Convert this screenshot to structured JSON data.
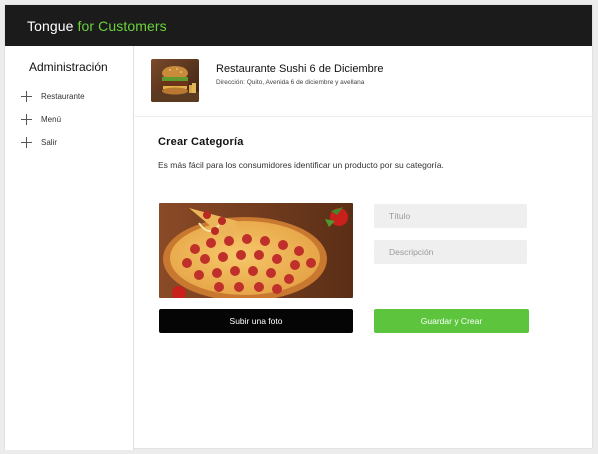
{
  "header": {
    "brand_main": "Tongue",
    "brand_accent": "for Customers",
    "accent_color": "#6ad33b"
  },
  "sidebar": {
    "title": "Administración",
    "items": [
      {
        "label": "Restaurante",
        "icon": "plus-icon"
      },
      {
        "label": "Menú",
        "icon": "plus-icon"
      },
      {
        "label": "Salir",
        "icon": "plus-icon"
      }
    ]
  },
  "restaurant": {
    "name": "Restaurante Sushi 6 de Diciembre",
    "address": "Dirección: Quito, Avenida 6 de diciembre y avellana"
  },
  "form": {
    "title": "Crear Categoría",
    "subtitle": "Es más fácil para los consumidores identificar un producto por su categoría.",
    "title_placeholder": "Título",
    "description_placeholder": "Descripción",
    "upload_label": "Subir una foto",
    "save_label": "Guardar y Crear",
    "save_color": "#5cc53d"
  }
}
